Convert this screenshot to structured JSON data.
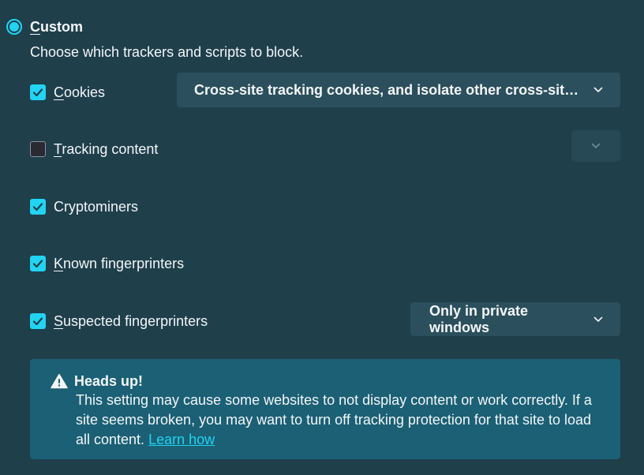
{
  "custom": {
    "label_first": "C",
    "label_rest": "ustom",
    "selected": true,
    "description": "Choose which trackers and scripts to block."
  },
  "options": [
    {
      "label_first": "C",
      "label_rest": "ookies",
      "checked": true
    },
    {
      "label_first": "T",
      "label_rest": "racking content",
      "checked": false
    },
    {
      "label_first": "",
      "label_rest": "Cryptominers",
      "checked": true
    },
    {
      "label_first": "K",
      "label_rest": "nown fingerprinters",
      "checked": true
    },
    {
      "label_first": "S",
      "label_rest": "uspected fingerprinters",
      "checked": true
    }
  ],
  "dropdowns": {
    "cookies": "Cross-site tracking cookies, and isolate other cross-site cookies",
    "tracking": "",
    "suspected_fingerprinters": "Only in private windows"
  },
  "warning": {
    "title": "Heads up!",
    "body": "This setting may cause some websites to not display content or work correctly. If a site seems broken, you may want to turn off tracking protection for that site to load all content.",
    "link": "Learn how"
  },
  "colors": {
    "background": "#1f3f4b",
    "accent": "#22d3f3",
    "dropdown_bg": "#2b4f5c",
    "warning_bg": "#1b6075",
    "text": "#f3f6f8"
  },
  "icons": {
    "radio": "radio-selected-icon",
    "checkbox_checked": "checkmark-icon",
    "chevron": "chevron-down-icon",
    "warning": "warning-triangle-icon"
  }
}
